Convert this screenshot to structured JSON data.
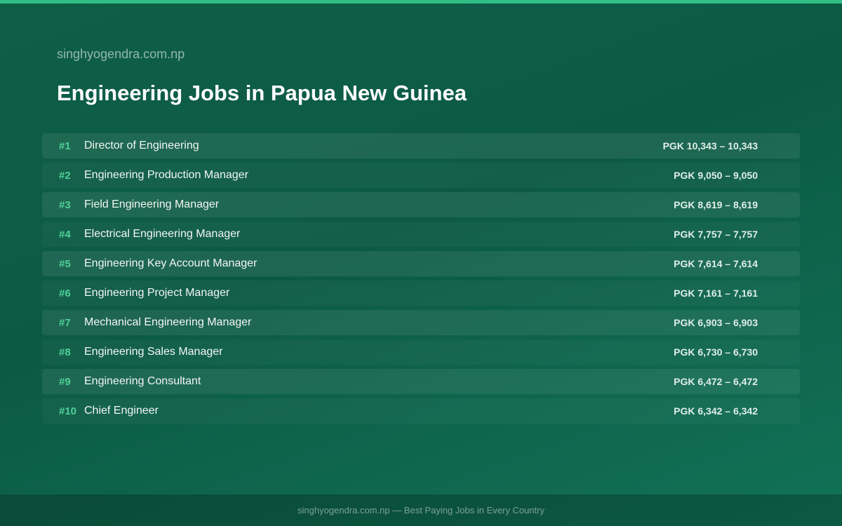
{
  "header": {
    "site_name": "singhyogendra.com.np",
    "title": "Engineering Jobs in Papua New Guinea"
  },
  "jobs": [
    {
      "rank": "#1",
      "title": "Director of Engineering",
      "salary": "PGK 10,343 – 10,343"
    },
    {
      "rank": "#2",
      "title": "Engineering Production Manager",
      "salary": "PGK 9,050 – 9,050"
    },
    {
      "rank": "#3",
      "title": "Field Engineering Manager",
      "salary": "PGK 8,619 – 8,619"
    },
    {
      "rank": "#4",
      "title": "Electrical Engineering Manager",
      "salary": "PGK 7,757 – 7,757"
    },
    {
      "rank": "#5",
      "title": "Engineering Key Account Manager",
      "salary": "PGK 7,614 – 7,614"
    },
    {
      "rank": "#6",
      "title": "Engineering Project Manager",
      "salary": "PGK 7,161 – 7,161"
    },
    {
      "rank": "#7",
      "title": "Mechanical Engineering Manager",
      "salary": "PGK 6,903 – 6,903"
    },
    {
      "rank": "#8",
      "title": "Engineering Sales Manager",
      "salary": "PGK 6,730 – 6,730"
    },
    {
      "rank": "#9",
      "title": "Engineering Consultant",
      "salary": "PGK 6,472 – 6,472"
    },
    {
      "rank": "#10",
      "title": "Chief Engineer",
      "salary": "PGK 6,342 – 6,342"
    }
  ],
  "footer": {
    "text": "singhyogendra.com.np — Best Paying Jobs in Every Country"
  },
  "colors": {
    "background": "#0f5f47",
    "accent": "#2fbf86",
    "rank": "#4fd199"
  }
}
